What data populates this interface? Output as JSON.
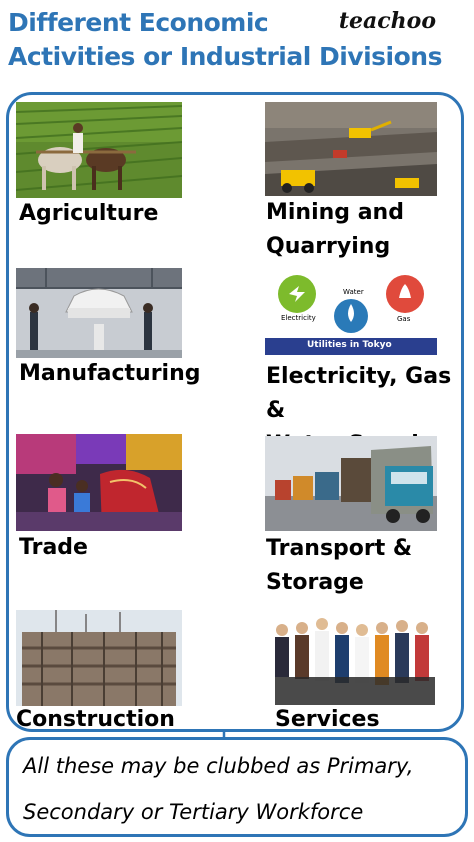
{
  "header": {
    "title_line1": "Different Economic",
    "title_line2": "Activities or Industrial Divisions",
    "brand": "teachoo"
  },
  "divisions": [
    {
      "label": "Agriculture",
      "icon": "ploughing-field-photo"
    },
    {
      "label": "Mining and",
      "label2": "Quarrying",
      "icon": "open-pit-mine-photo"
    },
    {
      "label": "Manufacturing",
      "icon": "car-assembly-line-photo"
    },
    {
      "label": "Electricity, Gas &",
      "label2": "Water Supply",
      "icon": "utilities-icons-photo",
      "image_text": {
        "electricity": "Electricity",
        "water": "Water",
        "gas": "Gas",
        "caption": "Utilities in Tokyo"
      }
    },
    {
      "label": "Trade",
      "icon": "textile-market-photo"
    },
    {
      "label": "Transport &",
      "label2": "Storage",
      "icon": "truck-convoy-photo"
    },
    {
      "label": "Construction",
      "icon": "building-construction-photo"
    },
    {
      "label": "Services",
      "icon": "service-workers-photo"
    }
  ],
  "note": {
    "line1": "All these may be clubbed as Primary,",
    "line2": "Secondary or Tertiary Workforce"
  },
  "colors": {
    "accent": "#2E75B6"
  }
}
